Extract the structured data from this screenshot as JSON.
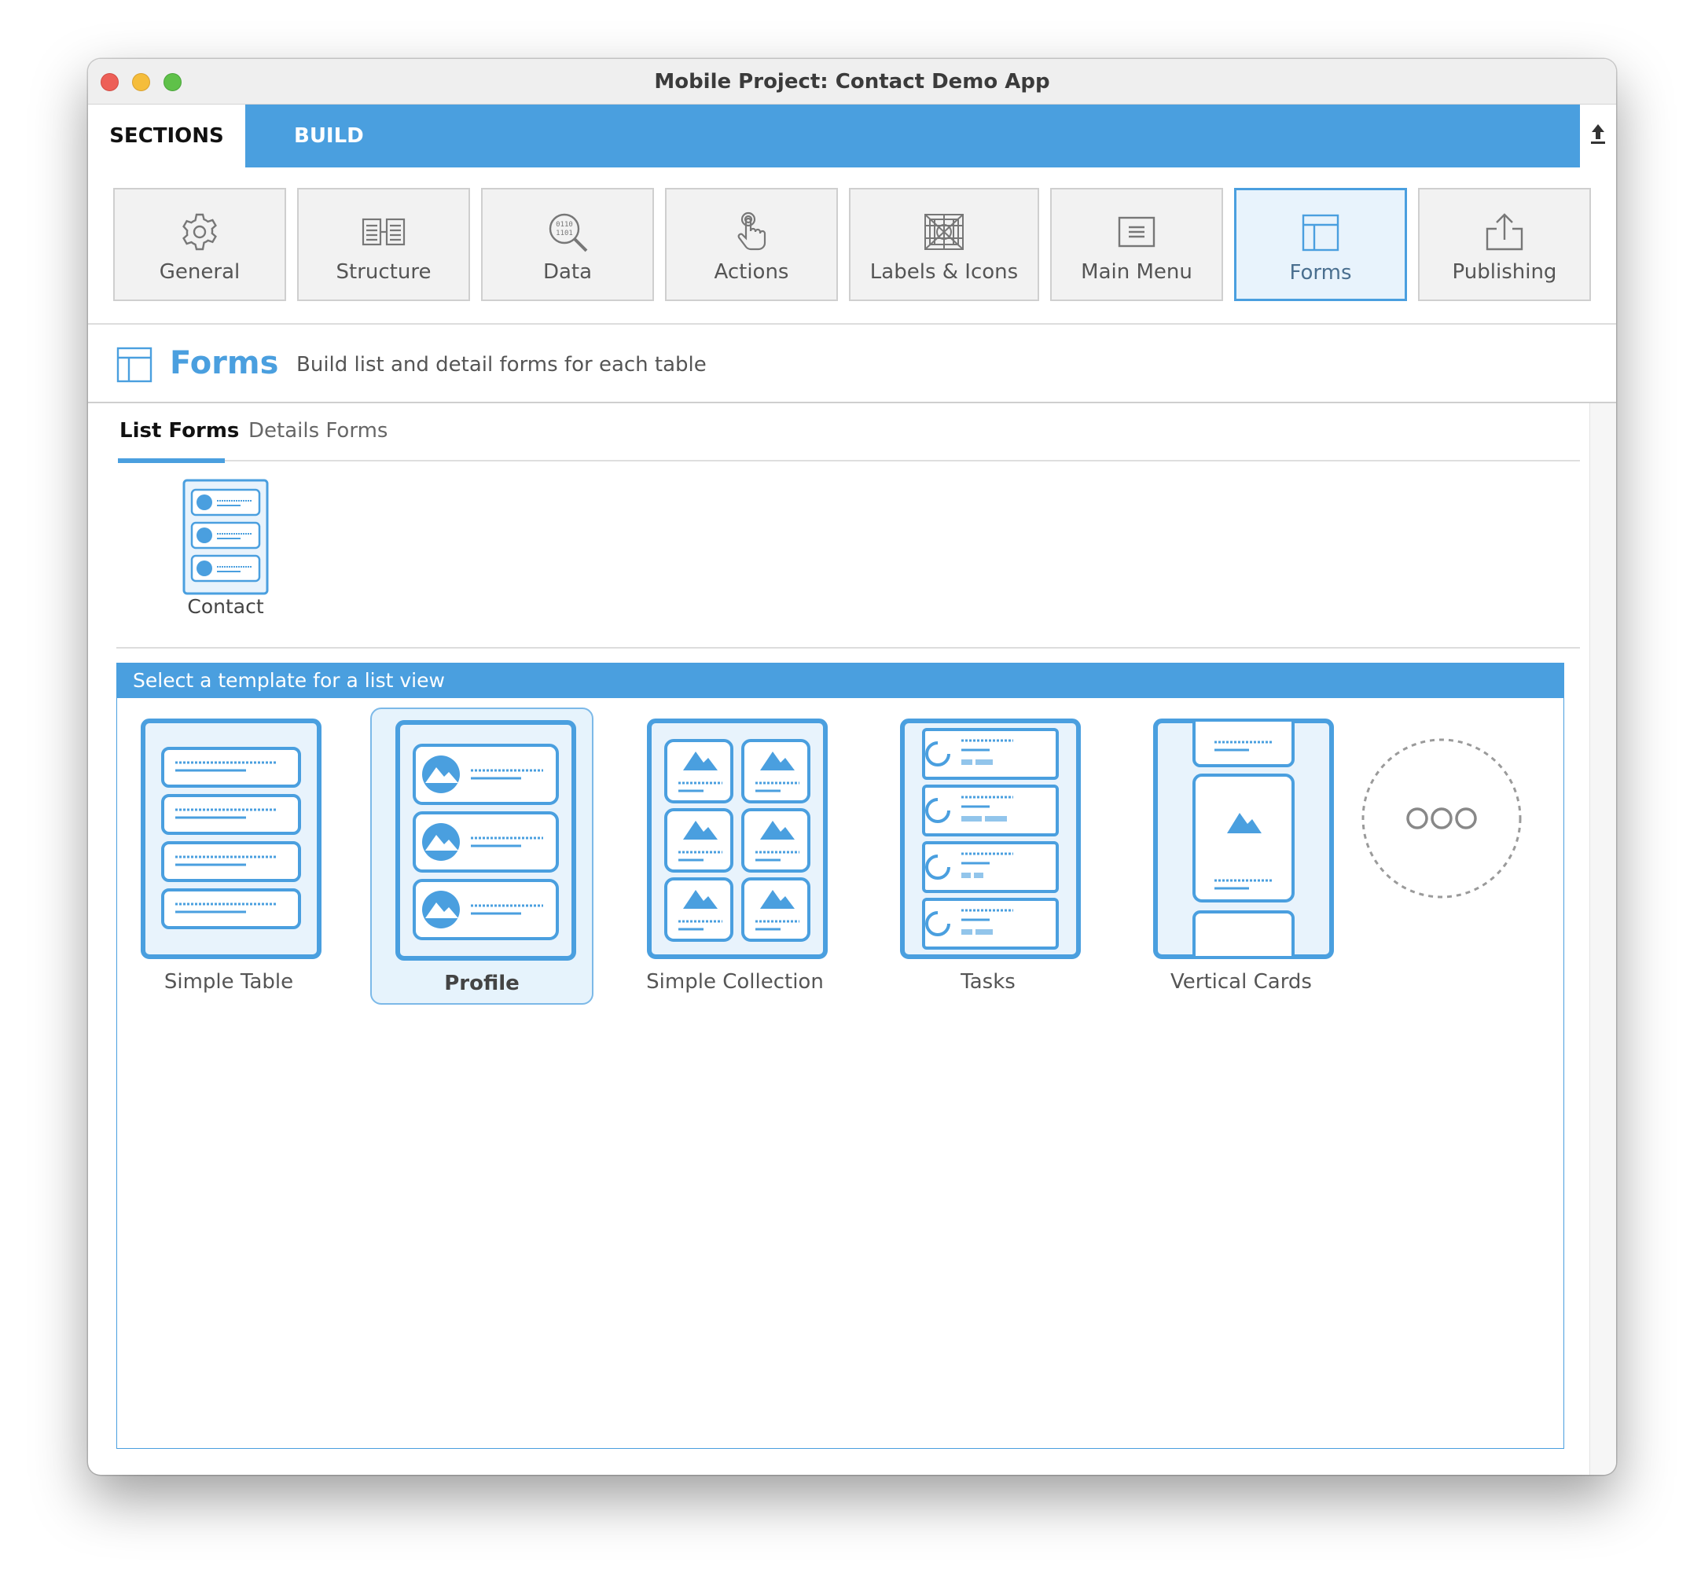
{
  "window": {
    "title": "Mobile Project: Contact Demo App"
  },
  "tabs": {
    "sections_label": "SECTIONS",
    "build_label": "BUILD"
  },
  "sections": {
    "items": [
      {
        "label": "General",
        "icon": "gear-icon"
      },
      {
        "label": "Structure",
        "icon": "structure-icon"
      },
      {
        "label": "Data",
        "icon": "data-search-icon"
      },
      {
        "label": "Actions",
        "icon": "touch-hand-icon"
      },
      {
        "label": "Labels & Icons",
        "icon": "labels-icons-icon"
      },
      {
        "label": "Main Menu",
        "icon": "menu-icon"
      },
      {
        "label": "Forms",
        "icon": "forms-icon",
        "active": true
      },
      {
        "label": "Publishing",
        "icon": "publish-upload-icon"
      }
    ]
  },
  "forms": {
    "title": "Forms",
    "description": "Build list and detail forms for each table",
    "subtabs": {
      "list": "List Forms",
      "details": "Details Forms"
    },
    "tables": [
      {
        "label": "Contact",
        "icon": "list-form-icon"
      }
    ],
    "template_header": "Select a template for a list view",
    "templates": [
      {
        "label": "Simple Table",
        "icon": "simple-table-template-icon"
      },
      {
        "label": "Profile",
        "icon": "profile-template-icon",
        "selected": true
      },
      {
        "label": "Simple Collection",
        "icon": "simple-collection-template-icon"
      },
      {
        "label": "Tasks",
        "icon": "tasks-template-icon"
      },
      {
        "label": "Vertical Cards",
        "icon": "vertical-cards-template-icon"
      }
    ],
    "more_icon": "more-templates-icon"
  },
  "colors": {
    "accent": "#4a9fdf",
    "selected_bg": "#e6f3fc"
  }
}
